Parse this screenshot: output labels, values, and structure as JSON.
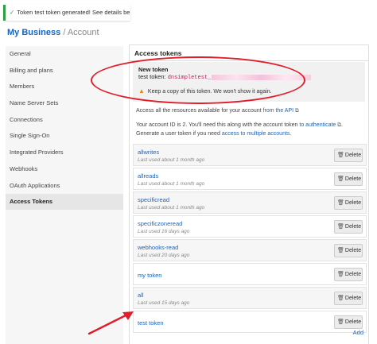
{
  "flash": {
    "text": "Token test token generated! See details below..."
  },
  "header": {
    "business": "My Business",
    "separator": "/",
    "section": "Account"
  },
  "sidebar": {
    "items": [
      {
        "label": "General",
        "active": false
      },
      {
        "label": "Billing and plans",
        "active": false
      },
      {
        "label": "Members",
        "active": false
      },
      {
        "label": "Name Server Sets",
        "active": false
      },
      {
        "label": "Connections",
        "active": false
      },
      {
        "label": "Single Sign-On",
        "active": false
      },
      {
        "label": "Integrated Providers",
        "active": false
      },
      {
        "label": "Webhooks",
        "active": false
      },
      {
        "label": "OAuth Applications",
        "active": false
      },
      {
        "label": "Access Tokens",
        "active": true
      }
    ]
  },
  "panel": {
    "title": "Access tokens",
    "new_token": {
      "title": "New token",
      "label": "test token:",
      "value_prefix": "dnsimpletest_",
      "warning": "Keep a copy of this token. We won't show it again."
    },
    "info1": {
      "before": "Access all the resources available for your account",
      "link": "from the API"
    },
    "info2": {
      "before": "Your account ID is 2. You'll need this along with the account token",
      "link1": "to authenticate",
      "middle": ". Generate a user token if you need",
      "link2": "access to multiple accounts",
      "after": "."
    },
    "delete_label": "Delete",
    "add_label": "Add",
    "tokens": [
      {
        "name": "allwrites",
        "last_used": "Last used about 1 month ago"
      },
      {
        "name": "allreads",
        "last_used": "Last used about 1 month ago"
      },
      {
        "name": "specificread",
        "last_used": "Last used about 1 month ago"
      },
      {
        "name": "specificzoneread",
        "last_used": "Last used 16 days ago"
      },
      {
        "name": "webhooks-read",
        "last_used": "Last used 20 days ago"
      },
      {
        "name": "my token",
        "last_used": ""
      },
      {
        "name": "all",
        "last_used": "Last used 15 days ago"
      },
      {
        "name": "test token",
        "last_used": ""
      }
    ]
  },
  "colors": {
    "link": "#1565c0",
    "annotation": "#e01e2a",
    "success": "#2f9e44",
    "warning": "#e8890c"
  }
}
